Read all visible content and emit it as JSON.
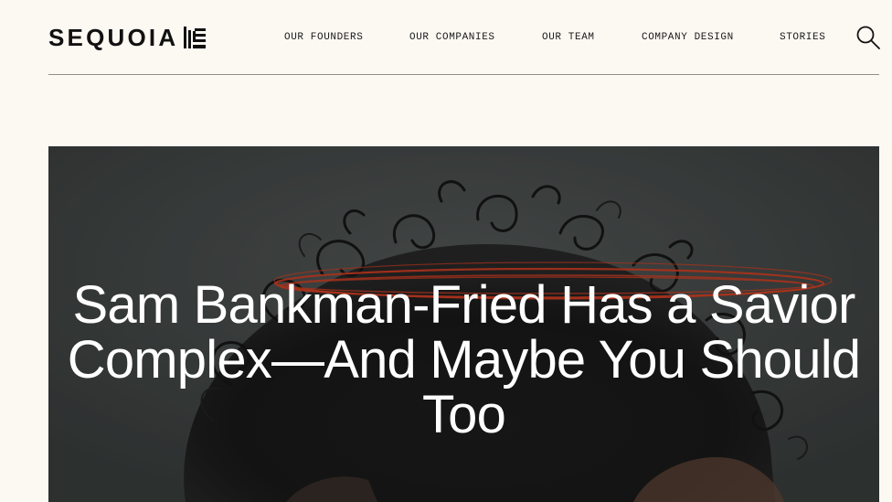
{
  "brand": {
    "name": "SEQUOIA"
  },
  "nav": {
    "items": [
      {
        "label": "OUR FOUNDERS"
      },
      {
        "label": "OUR COMPANIES"
      },
      {
        "label": "OUR TEAM"
      },
      {
        "label": "COMPANY DESIGN"
      },
      {
        "label": "STORIES"
      }
    ],
    "search_icon": "search-icon"
  },
  "hero": {
    "title": "Sam Bankman-Fried Has a Savior Complex—And Maybe You Should Too",
    "image": "portrait-photo-with-red-halo"
  },
  "colors": {
    "page_background": "#fcf9f3",
    "text_dark": "#111111",
    "rule": "#8e8e8e",
    "hero_background": "#3f4342",
    "halo": "#c2391f",
    "hero_text": "#ffffff"
  }
}
